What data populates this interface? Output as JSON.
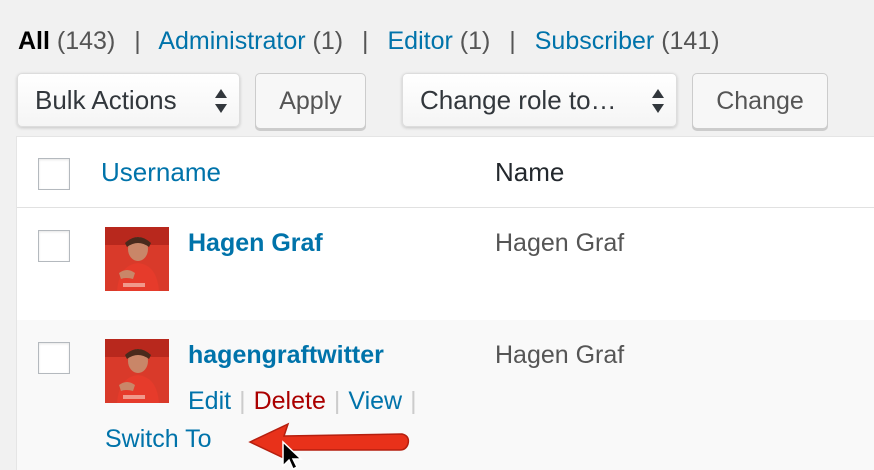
{
  "filters": [
    {
      "label": "All",
      "count": "(143)",
      "current": true
    },
    {
      "label": "Administrator",
      "count": "(1)"
    },
    {
      "label": "Editor",
      "count": "(1)"
    },
    {
      "label": "Subscriber",
      "count": "(141)"
    }
  ],
  "separator": "|",
  "toolbar": {
    "bulk_actions": "Bulk Actions",
    "apply": "Apply",
    "change_role": "Change role to…",
    "change": "Change"
  },
  "table": {
    "columns": {
      "username": "Username",
      "name": "Name"
    },
    "rows": [
      {
        "username": "Hagen Graf",
        "name": "Hagen Graf"
      },
      {
        "username": "hagengraftwitter",
        "name": "Hagen Graf",
        "actions": {
          "edit": "Edit",
          "delete": "Delete",
          "view": "View",
          "switch_to": "Switch To"
        }
      }
    ]
  },
  "colors": {
    "link": "#0073aa",
    "delete": "#aa0000",
    "annotation": "#e8311a"
  },
  "icons": [
    "select-arrows-icon",
    "avatar",
    "annotation-arrow",
    "mouse-cursor-icon"
  ]
}
